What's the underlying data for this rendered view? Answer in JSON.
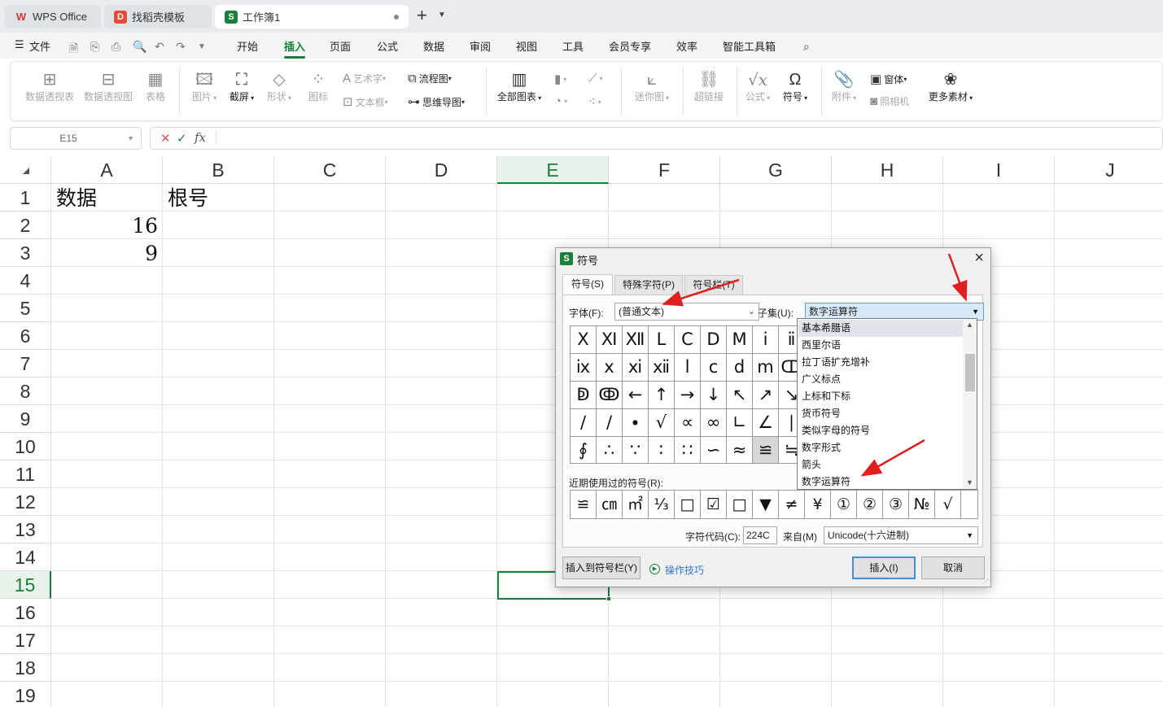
{
  "tabs": [
    {
      "label": "WPS Office",
      "logo": "W",
      "color": "#d13b2e"
    },
    {
      "label": "找稻壳模板",
      "logo": "D",
      "color": "#e84a3a"
    },
    {
      "label": "工作簿1",
      "logo": "S",
      "color": "#1a7f3c"
    }
  ],
  "menu": {
    "file": "文件",
    "items": [
      "开始",
      "插入",
      "页面",
      "公式",
      "数据",
      "审阅",
      "视图",
      "工具",
      "会员专享",
      "效率",
      "智能工具箱"
    ],
    "selected": "插入"
  },
  "ribbon": {
    "pivot_table": "数据透视表",
    "pivot_chart": "数据透视图",
    "table": "表格",
    "picture": "图片",
    "screenshot": "截屏",
    "shape": "形状",
    "icon": "图标",
    "art_text": "艺术字",
    "textbox": "文本框",
    "flowchart": "流程图",
    "mindmap": "思维导图",
    "all_charts": "全部图表",
    "sparkline": "迷你图",
    "hyperlink": "超链接",
    "formula": "公式",
    "symbol": "符号",
    "attachment": "附件",
    "form": "窗体",
    "camera": "照相机",
    "more_materials": "更多素材"
  },
  "formula_bar": {
    "cell_ref": "E15",
    "fx": "fx"
  },
  "sheet": {
    "columns": [
      "A",
      "B",
      "C",
      "D",
      "E",
      "F",
      "G",
      "H",
      "I",
      "J"
    ],
    "rows": [
      "1",
      "2",
      "3",
      "4",
      "5",
      "6",
      "7",
      "8",
      "9",
      "10",
      "11",
      "12",
      "13",
      "14",
      "15",
      "16",
      "17",
      "18",
      "19"
    ],
    "cells": {
      "A1": "数据",
      "B1": "根号",
      "A2": "16",
      "A3": "9"
    },
    "selected_cell": "E15"
  },
  "dialog": {
    "title": "符号",
    "tabs": [
      "符号(S)",
      "特殊字符(P)",
      "符号栏(T)"
    ],
    "font_label": "字体(F):",
    "font_value": "(普通文本)",
    "subset_label": "子集(U):",
    "subset_value": "数字运算符",
    "subset_options": [
      "基本希腊语",
      "西里尔语",
      "拉丁语扩充增补",
      "广义标点",
      "上标和下标",
      "货币符号",
      "类似字母的符号",
      "数字形式",
      "箭头",
      "数字运算符"
    ],
    "subset_highlight": "基本希腊语",
    "symbols": [
      [
        "Ⅹ",
        "Ⅺ",
        "Ⅻ",
        "Ⅼ",
        "Ⅽ",
        "Ⅾ",
        "Ⅿ",
        "ⅰ",
        "ⅱ"
      ],
      [
        "ⅸ",
        "ⅹ",
        "ⅺ",
        "ⅻ",
        "ⅼ",
        "ⅽ",
        "ⅾ",
        "ⅿ",
        "ↀ"
      ],
      [
        "ↁ",
        "ↂ",
        "←",
        "↑",
        "→",
        "↓",
        "↖",
        "↗",
        "↘"
      ],
      [
        "∕",
        "/",
        "∙",
        "√",
        "∝",
        "∞",
        "∟",
        "∠",
        "∣"
      ],
      [
        "∮",
        "∴",
        "∵",
        "∶",
        "∷",
        "∽",
        "≈",
        "≌",
        "≒"
      ]
    ],
    "highlighted_symbol": "≌",
    "recent_label": "近期使用过的符号(R):",
    "recent_symbols": [
      "≌",
      "㎝",
      "㎡",
      "⅓",
      "□",
      "☑",
      "□",
      "▼",
      "≠",
      "¥",
      "①",
      "②",
      "③",
      "№",
      "√"
    ],
    "code_label": "字符代码(C):",
    "code_value": "224C",
    "from_label": "来自(M)",
    "from_value": "Unicode(十六进制)",
    "insert_to_bar": "插入到符号栏(Y)",
    "tips": "操作技巧",
    "insert": "插入(I)",
    "cancel": "取消"
  },
  "colors": {
    "accent": "#1a7f3c",
    "annotation": "#e02020",
    "link": "#3679c9"
  }
}
